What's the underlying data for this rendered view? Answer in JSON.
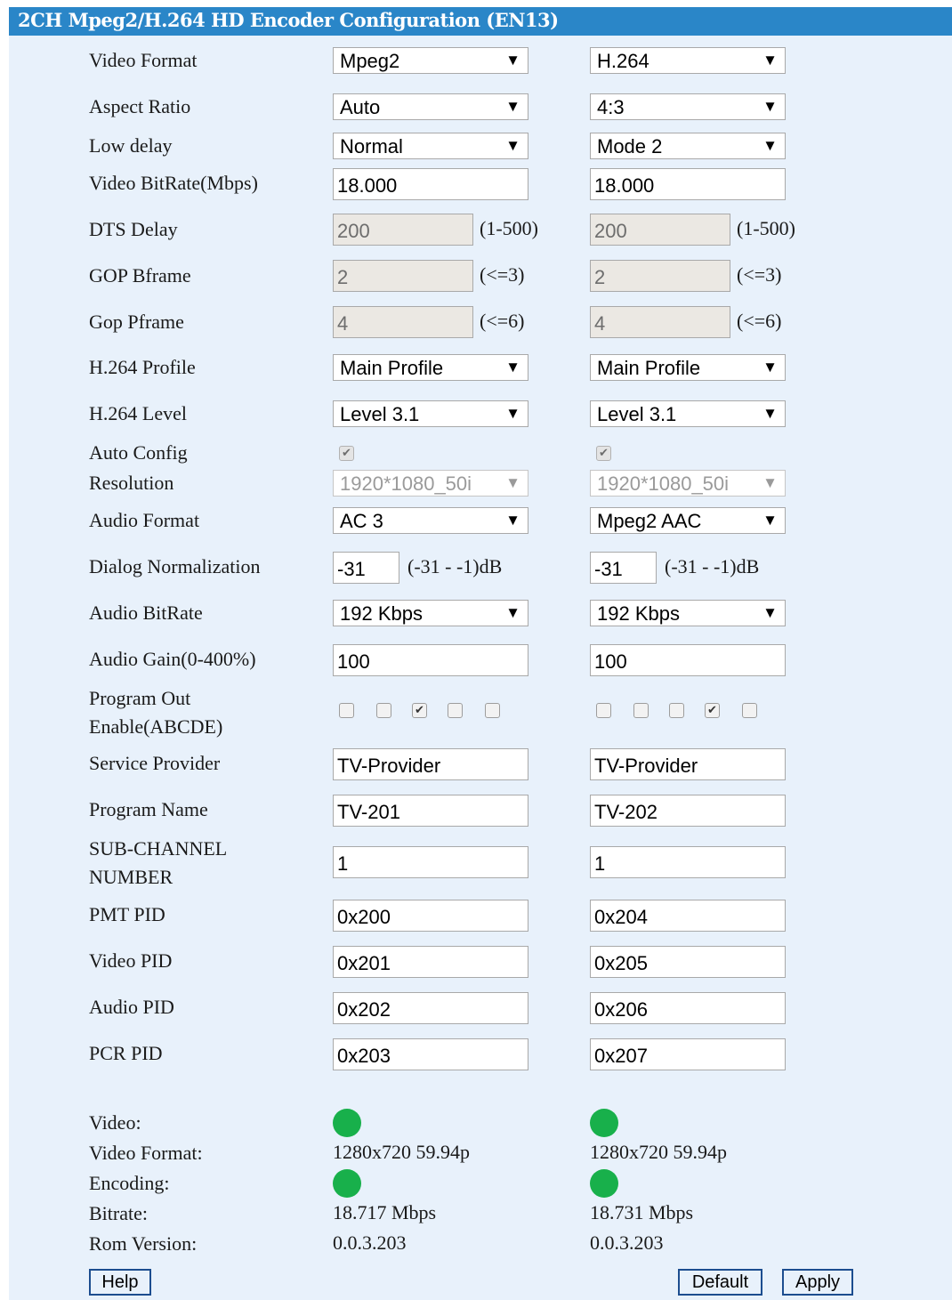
{
  "title": "2CH Mpeg2/H.264 HD Encoder Configuration (EN13)",
  "labels": {
    "video_format": "Video Format",
    "aspect_ratio": "Aspect Ratio",
    "low_delay": "Low delay",
    "video_bitrate": "Video BitRate(Mbps)",
    "dts_delay": "DTS Delay",
    "gop_bframe": "GOP Bframe",
    "gop_pframe": "Gop Pframe",
    "h264_profile": "H.264 Profile",
    "h264_level": "H.264 Level",
    "auto_config": "Auto Config",
    "resolution": "Resolution",
    "audio_format": "Audio Format",
    "dialog_normalization": "Dialog Normalization",
    "audio_bitrate": "Audio BitRate",
    "audio_gain": "Audio Gain(0-400%)",
    "program_out_1": "Program Out",
    "program_out_2": "Enable(ABCDE)",
    "service_provider": "Service Provider",
    "program_name": "Program Name",
    "sub_channel_1": "SUB-CHANNEL",
    "sub_channel_2": "NUMBER",
    "pmt_pid": "PMT PID",
    "video_pid": "Video PID",
    "audio_pid": "Audio PID",
    "pcr_pid": "PCR PID",
    "status_video": "Video:",
    "status_video_format": "Video Format:",
    "status_encoding": "Encoding:",
    "status_bitrate": "Bitrate:",
    "status_rom": "Rom Version:"
  },
  "hints": {
    "dts": "(1-500)",
    "gop_b": "(<=3)",
    "gop_p": "(<=6)",
    "dialnorm": "(-31 - -1)dB"
  },
  "channels": [
    {
      "video_format": "Mpeg2",
      "aspect_ratio": "Auto",
      "low_delay": "Normal",
      "video_bitrate": "18.000",
      "dts_delay": "200",
      "gop_bframe": "2",
      "gop_pframe": "4",
      "h264_profile": "Main Profile",
      "h264_level": "Level 3.1",
      "auto_config": true,
      "resolution": "1920*1080_50i",
      "audio_format": "AC 3",
      "dialog_normalization": "-31",
      "audio_bitrate": "192 Kbps",
      "audio_gain": "100",
      "program_out": [
        false,
        false,
        true,
        false,
        false
      ],
      "service_provider": "TV-Provider",
      "program_name": "TV-201",
      "sub_channel": "1",
      "pmt_pid": "0x200",
      "video_pid": "0x201",
      "audio_pid": "0x202",
      "pcr_pid": "0x203",
      "status": {
        "video_ok": true,
        "video_format": "1280x720 59.94p",
        "encoding_ok": true,
        "bitrate": "18.717 Mbps",
        "rom_version": "0.0.3.203"
      }
    },
    {
      "video_format": "H.264",
      "aspect_ratio": "4:3",
      "low_delay": "Mode 2",
      "video_bitrate": "18.000",
      "dts_delay": "200",
      "gop_bframe": "2",
      "gop_pframe": "4",
      "h264_profile": "Main Profile",
      "h264_level": "Level 3.1",
      "auto_config": true,
      "resolution": "1920*1080_50i",
      "audio_format": "Mpeg2 AAC",
      "dialog_normalization": "-31",
      "audio_bitrate": "192 Kbps",
      "audio_gain": "100",
      "program_out": [
        false,
        false,
        false,
        true,
        false
      ],
      "service_provider": "TV-Provider",
      "program_name": "TV-202",
      "sub_channel": "1",
      "pmt_pid": "0x204",
      "video_pid": "0x205",
      "audio_pid": "0x206",
      "pcr_pid": "0x207",
      "status": {
        "video_ok": true,
        "video_format": "1280x720 59.94p",
        "encoding_ok": true,
        "bitrate": "18.731 Mbps",
        "rom_version": "0.0.3.203"
      }
    }
  ],
  "buttons": {
    "help": "Help",
    "default": "Default",
    "apply": "Apply"
  },
  "colors": {
    "title_bar": "#2a86c8",
    "panel_bg": "#e8f1fb",
    "status_ok": "#18b04b",
    "readonly_bg": "#ebe8e3"
  },
  "icons": {
    "dropdown": "triangle-down-icon",
    "check": "checkmark-icon",
    "status": "green-circle-icon"
  }
}
